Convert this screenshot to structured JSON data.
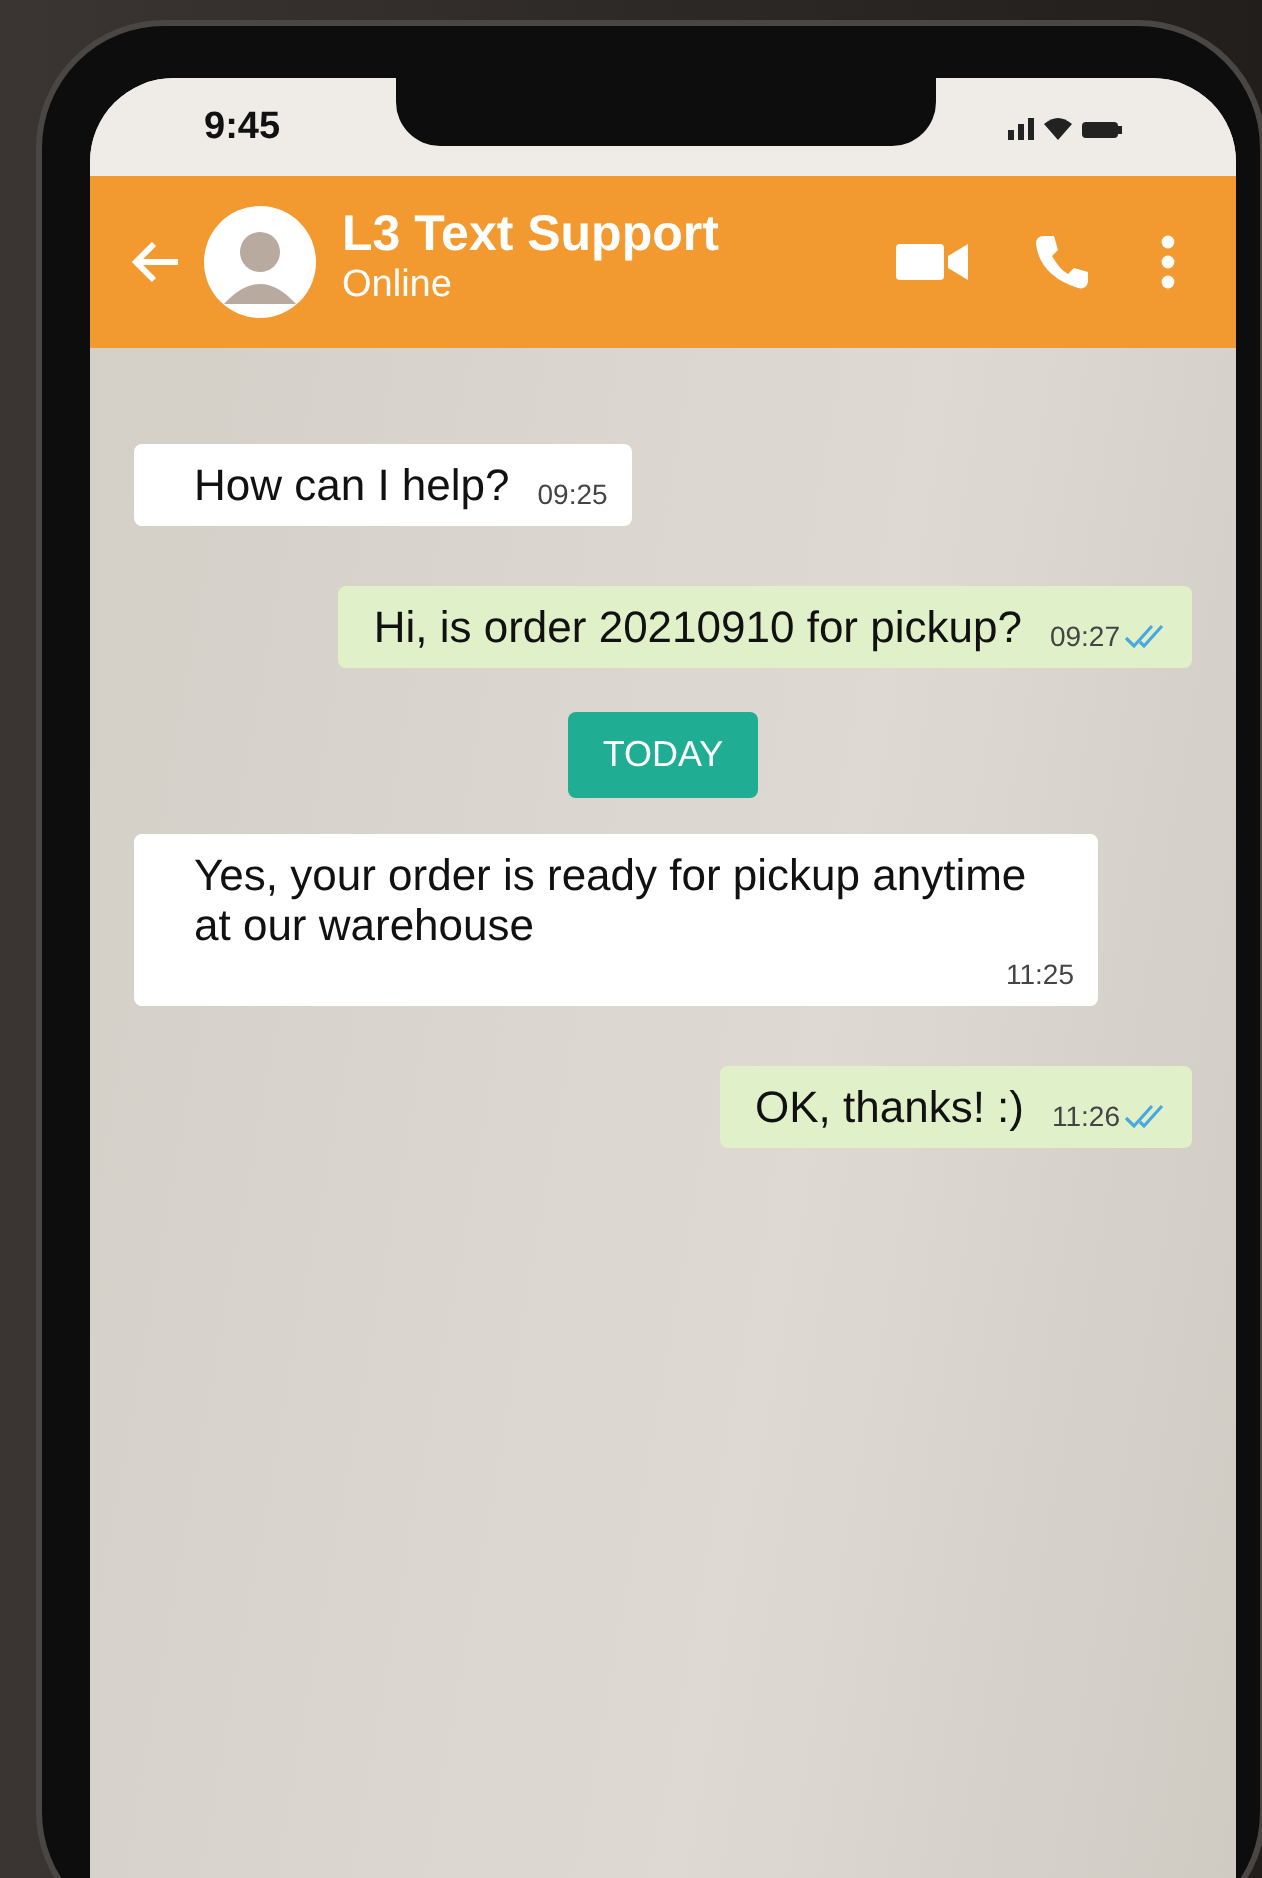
{
  "status_bar": {
    "time": "9:45"
  },
  "header": {
    "name": "L3 Text Support",
    "status": "Online"
  },
  "messages": [
    {
      "kind": "incoming",
      "text": "How can I help?",
      "time": "09:25"
    },
    {
      "kind": "outgoing",
      "text": "Hi, is order 20210910 for pickup?",
      "time": "09:27",
      "read": true
    },
    {
      "kind": "date",
      "text": "TODAY"
    },
    {
      "kind": "incoming",
      "text": "Yes, your order is ready for pickup anytime at our warehouse",
      "time": "11:25"
    },
    {
      "kind": "outgoing",
      "text": "OK, thanks! :)",
      "time": "11:26",
      "read": true
    }
  ]
}
